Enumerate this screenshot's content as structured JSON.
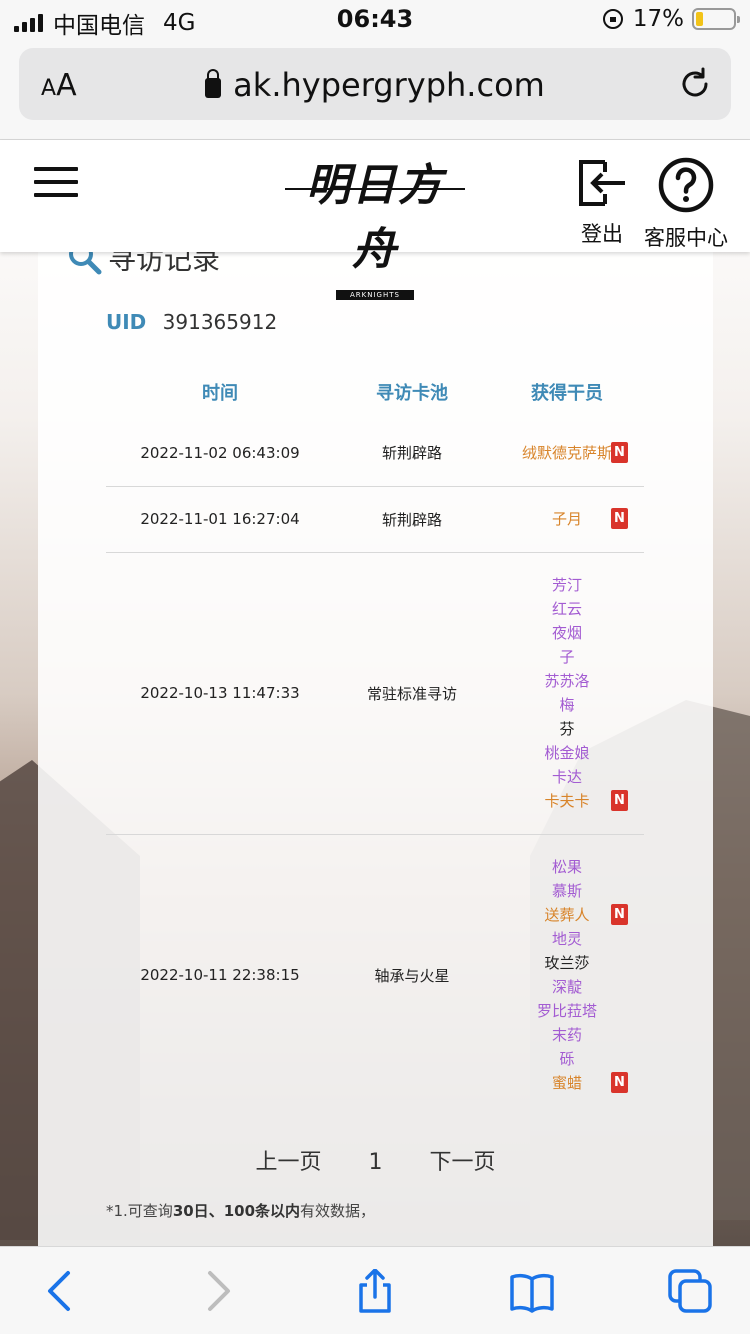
{
  "status_bar": {
    "carrier": "中国电信",
    "network": "4G",
    "time": "06:43",
    "battery": "17%",
    "battery_level": 0.17
  },
  "browser": {
    "text_size_label": "AA",
    "url": "ak.hypergryph.com"
  },
  "header": {
    "logo_text": "明日方舟",
    "logo_sub": "ARKNIGHTS",
    "logout_label": "登出",
    "service_label": "客服中心"
  },
  "card": {
    "title": "寻访记录",
    "uid_label": "UID",
    "uid_value": "391365912",
    "columns": [
      "时间",
      "寻访卡池",
      "获得干员"
    ],
    "colors": {
      "orange": "#d8842a",
      "purple": "#a35cd2",
      "black": "#222222",
      "badge": "#d9342b",
      "accent": "#3f8ab6"
    },
    "rows": [
      {
        "time": "2022-11-02 06:43:09",
        "pool": "斩荆辟路",
        "operators": [
          {
            "name": "绒默德克萨斯",
            "color": "orange",
            "new": "N"
          }
        ]
      },
      {
        "time": "2022-11-01 16:27:04",
        "pool": "斩荆辟路",
        "operators": [
          {
            "name": "子月",
            "color": "orange",
            "new": "N"
          }
        ]
      },
      {
        "time": "2022-10-13 11:47:33",
        "pool": "常驻标准寻访",
        "operators": [
          {
            "name": "芳汀",
            "color": "purple",
            "new": ""
          },
          {
            "name": "红云",
            "color": "purple",
            "new": ""
          },
          {
            "name": "夜烟",
            "color": "purple",
            "new": ""
          },
          {
            "name": "子",
            "color": "purple",
            "new": ""
          },
          {
            "name": "苏苏洛",
            "color": "purple",
            "new": ""
          },
          {
            "name": "梅",
            "color": "purple",
            "new": ""
          },
          {
            "name": "芬",
            "color": "black",
            "new": ""
          },
          {
            "name": "桃金娘",
            "color": "purple",
            "new": ""
          },
          {
            "name": "卡达",
            "color": "purple",
            "new": ""
          },
          {
            "name": "卡夫卡",
            "color": "orange",
            "new": "N"
          }
        ]
      },
      {
        "time": "2022-10-11 22:38:15",
        "pool": "轴承与火星",
        "operators": [
          {
            "name": "松果",
            "color": "purple",
            "new": ""
          },
          {
            "name": "慕斯",
            "color": "purple",
            "new": ""
          },
          {
            "name": "送葬人",
            "color": "orange",
            "new": "N"
          },
          {
            "name": "地灵",
            "color": "purple",
            "new": ""
          },
          {
            "name": "玫兰莎",
            "color": "black",
            "new": ""
          },
          {
            "name": "深靛",
            "color": "purple",
            "new": ""
          },
          {
            "name": "罗比菈塔",
            "color": "purple",
            "new": ""
          },
          {
            "name": "末药",
            "color": "purple",
            "new": ""
          },
          {
            "name": "砾",
            "color": "purple",
            "new": ""
          },
          {
            "name": "蜜蜡",
            "color": "orange",
            "new": "N"
          }
        ]
      }
    ],
    "pager": {
      "prev": "上一页",
      "current": "1",
      "next": "下一页"
    },
    "note": {
      "prefix": "*1.可查询",
      "days": "30日",
      "sep": "、",
      "count": "100条以内",
      "suffix": "有效数据，"
    }
  },
  "toolbar": {
    "items": [
      "back-icon",
      "forward-icon",
      "share-icon",
      "bookmarks-icon",
      "tabs-icon"
    ]
  }
}
